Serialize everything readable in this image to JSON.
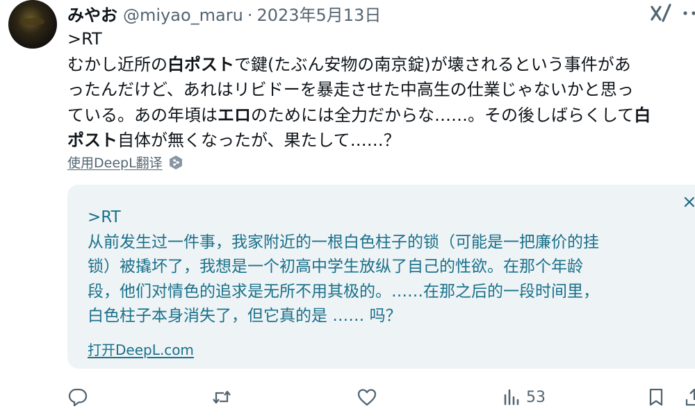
{
  "tweet": {
    "display_name": "みやお",
    "handle": "@miyao_maru",
    "separator": "·",
    "date": "2023年5月13日",
    "text_lines": [
      [
        {
          "t": ">RT",
          "b": false
        }
      ],
      [
        {
          "t": "むかし近所の",
          "b": false
        },
        {
          "t": "白ポスト",
          "b": true
        },
        {
          "t": "で鍵(たぶん安物の南京錠)が壊されるという事件があ",
          "b": false
        }
      ],
      [
        {
          "t": "ったんだけど、あれはリビドーを暴走させた中高生の仕業じゃないかと思っ",
          "b": false
        }
      ],
      [
        {
          "t": "ている。あの年頃は",
          "b": false
        },
        {
          "t": "エロ",
          "b": true
        },
        {
          "t": "のためには全力だからな……。その後しばらくして",
          "b": false
        },
        {
          "t": "白",
          "b": true
        }
      ],
      [
        {
          "t": "ポスト",
          "b": true
        },
        {
          "t": "自体が無くなったが、果たして……？",
          "b": false
        }
      ]
    ],
    "translate_label": "使用DeepL翻译"
  },
  "translation": {
    "lines": [
      ">RT",
      "从前发生过一件事，我家附近的一根白色柱子的锁（可能是一把廉价的挂",
      "锁）被撬坏了，我想是一个初高中学生放纵了自己的性欲。在那个年龄",
      "段，他们对情色的追求是无所不用其极的。……在那之后的一段时间里，",
      "白色柱子本身消失了，但它真的是 …… 吗？"
    ],
    "close_label": "×",
    "open_link": "打开DeepL.com"
  },
  "actions": {
    "views": "53",
    "icons": [
      "reply-icon",
      "retweet-icon",
      "like-icon",
      "views-icon",
      "bookmark-icon",
      "share-icon"
    ]
  },
  "colors": {
    "text": "#0f1419",
    "secondary": "#536471",
    "translation_text": "#19708a",
    "translation_bg": "#eef3f5"
  }
}
